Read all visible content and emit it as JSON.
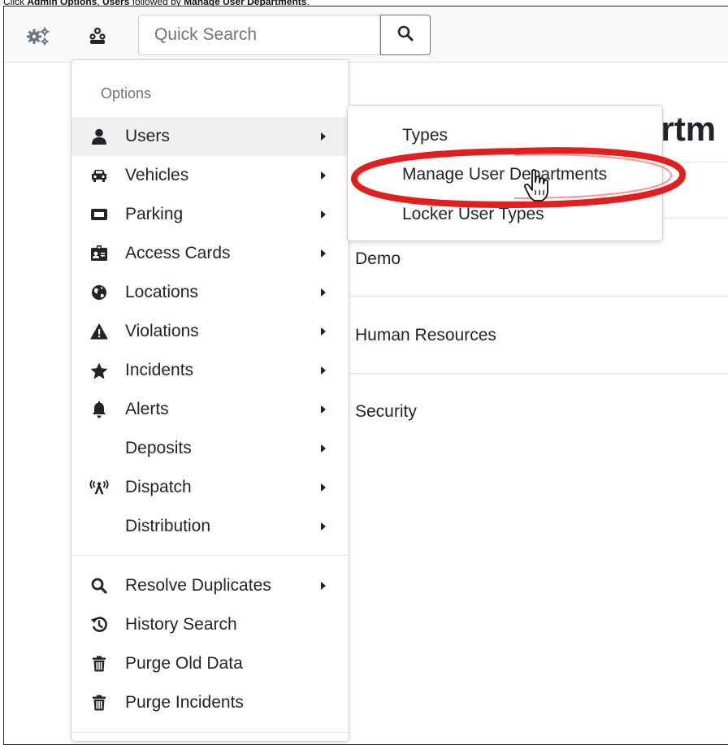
{
  "caption": {
    "prefix": "Click ",
    "bold1": "Admin Options",
    "sep": ", ",
    "bold2": "Users",
    "middle": " followed by ",
    "bold3": "Manage User Departments",
    "suffix": "."
  },
  "topbar": {
    "search_placeholder": "Quick Search",
    "icons": [
      "gears-icon",
      "users-icon",
      "search-icon"
    ]
  },
  "page": {
    "title_fragment": "artm",
    "rows": [
      "Demo",
      "Human Resources",
      "Security"
    ]
  },
  "menu": {
    "header": "Options",
    "items": [
      {
        "label": "Users",
        "icon": "user-icon",
        "submenu": true
      },
      {
        "label": "Vehicles",
        "icon": "car-icon",
        "submenu": true
      },
      {
        "label": "Parking",
        "icon": "parking-icon",
        "submenu": true
      },
      {
        "label": "Access Cards",
        "icon": "id-badge-icon",
        "submenu": true
      },
      {
        "label": "Locations",
        "icon": "globe-icon",
        "submenu": true
      },
      {
        "label": "Violations",
        "icon": "warning-icon",
        "submenu": true
      },
      {
        "label": "Incidents",
        "icon": "star-icon",
        "submenu": true
      },
      {
        "label": "Alerts",
        "icon": "bell-icon",
        "submenu": true
      },
      {
        "label": "Deposits",
        "icon": "",
        "submenu": true
      },
      {
        "label": "Dispatch",
        "icon": "radio-tower-icon",
        "submenu": true
      },
      {
        "label": "Distribution",
        "icon": "",
        "submenu": true
      }
    ],
    "tools": [
      {
        "label": "Resolve Duplicates",
        "icon": "search-icon",
        "submenu": true
      },
      {
        "label": "History Search",
        "icon": "history-icon",
        "submenu": false
      },
      {
        "label": "Purge Old Data",
        "icon": "trash-icon",
        "submenu": false
      },
      {
        "label": "Purge Incidents",
        "icon": "trash-icon",
        "submenu": false
      }
    ]
  },
  "submenu": {
    "items": [
      "Types",
      "Manage User Departments",
      "Locker User Types"
    ]
  },
  "colors": {
    "highlight_ring": "#e01f1f",
    "topbar_bg": "#f8f9fa",
    "text": "#212529",
    "muted": "#6c757d"
  }
}
